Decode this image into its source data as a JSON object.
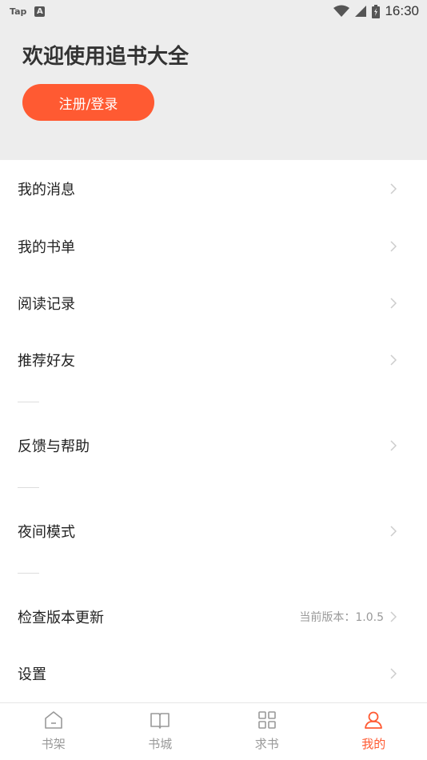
{
  "status_bar": {
    "left_text": "Tap",
    "left_badge": "A",
    "time": "16:30"
  },
  "header": {
    "welcome_title": "欢迎使用追书大全",
    "login_button": "注册/登录"
  },
  "menu": {
    "items": [
      {
        "label": "我的消息"
      },
      {
        "label": "我的书单"
      },
      {
        "label": "阅读记录"
      },
      {
        "label": "推荐好友"
      },
      {
        "label": "反馈与帮助"
      },
      {
        "label": "夜间模式"
      },
      {
        "label": "检查版本更新",
        "extra": "当前版本：1.0.5"
      },
      {
        "label": "设置"
      }
    ]
  },
  "bottom_nav": {
    "items": [
      {
        "label": "书架",
        "icon": "house-icon"
      },
      {
        "label": "书城",
        "icon": "book-icon"
      },
      {
        "label": "求书",
        "icon": "grid-icon"
      },
      {
        "label": "我的",
        "icon": "user-icon",
        "active": true
      }
    ]
  },
  "colors": {
    "accent": "#ff5a32",
    "header_bg": "#ededed",
    "inactive": "#999999"
  }
}
